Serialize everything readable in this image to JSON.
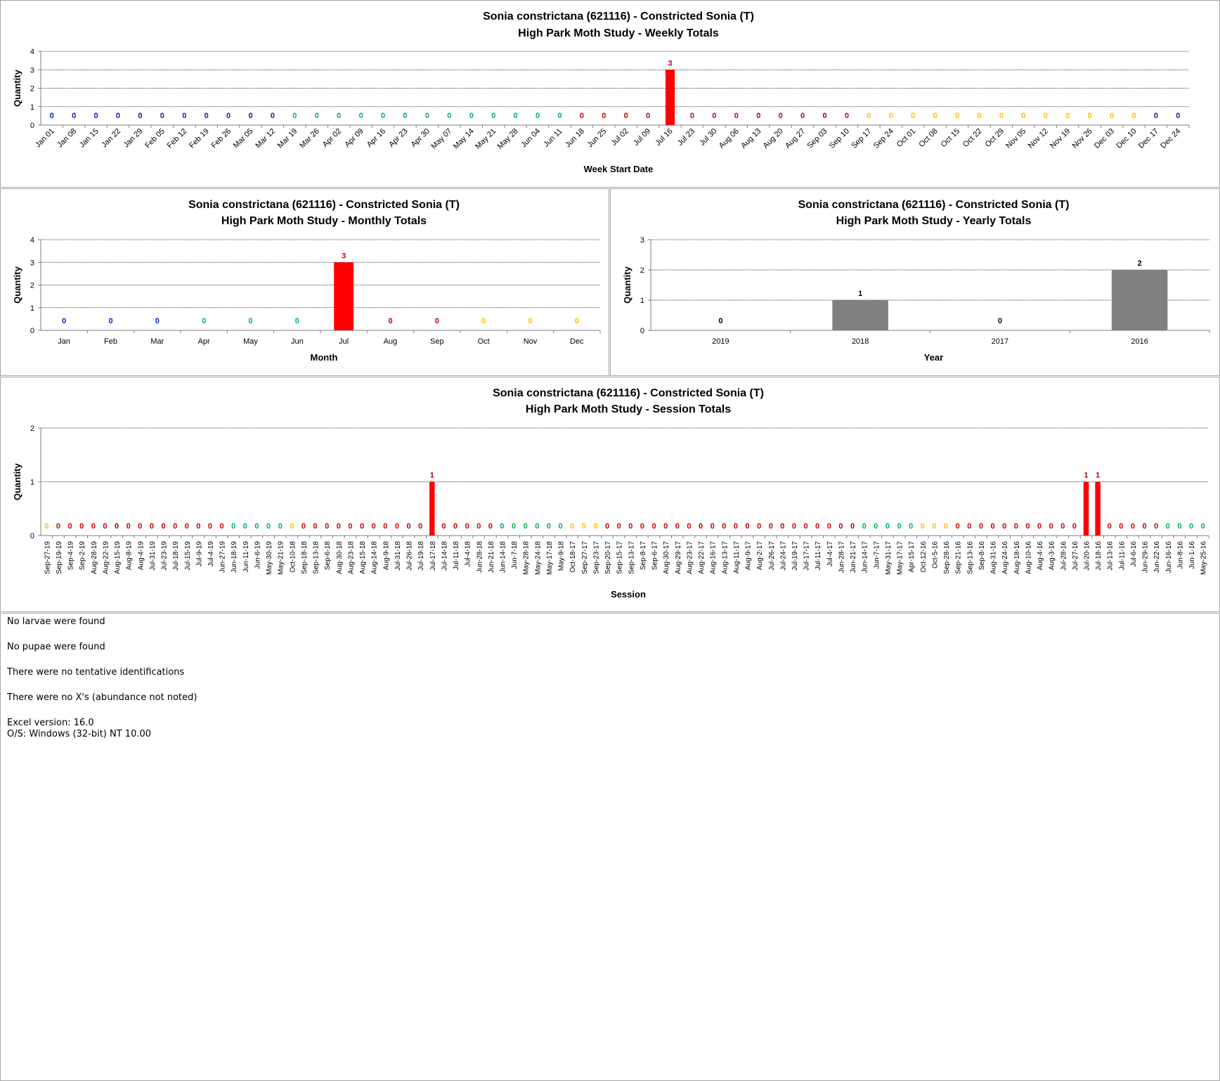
{
  "colors": {
    "bar_red": "#ff0000",
    "bar_gray": "#808080",
    "label_red": "#c00000",
    "label_blue": "#0020c0",
    "label_green": "#00b050",
    "label_yellow": "#ffc000",
    "label_black": "#000000"
  },
  "chart_data": [
    {
      "id": "weekly",
      "type": "bar",
      "title": "Sonia constrictana (621116)  - Constricted Sonia (T)",
      "subtitle": "High Park Moth Study  -  Weekly Totals",
      "xlabel": "Week Start Date",
      "ylabel": "Quantity",
      "ylim": [
        0,
        4
      ],
      "yticks": [
        0,
        1,
        2,
        3,
        4
      ],
      "grid": true,
      "bar_color": "#ff0000",
      "categories": [
        "Jan 01",
        "Jan 08",
        "Jan 15",
        "Jan 22",
        "Jan 29",
        "Feb 05",
        "Feb 12",
        "Feb 19",
        "Feb 26",
        "Mar 05",
        "Mar 12",
        "Mar 19",
        "Mar 26",
        "Apr 02",
        "Apr 09",
        "Apr 16",
        "Apr 23",
        "Apr 30",
        "May 07",
        "May 14",
        "May 21",
        "May 28",
        "Jun 04",
        "Jun 11",
        "Jun 18",
        "Jun 25",
        "Jul 02",
        "Jul 09",
        "Jul 16",
        "Jul 23",
        "Jul 30",
        "Aug 06",
        "Aug 13",
        "Aug 20",
        "Aug 27",
        "Sep 03",
        "Sep 10",
        "Sep 17",
        "Sep 24",
        "Oct 01",
        "Oct 08",
        "Oct 15",
        "Oct 22",
        "Oct 29",
        "Nov 05",
        "Nov 12",
        "Nov 19",
        "Nov 26",
        "Dec 03",
        "Dec 10",
        "Dec 17",
        "Dec 24"
      ],
      "values": [
        0,
        0,
        0,
        0,
        0,
        0,
        0,
        0,
        0,
        0,
        0,
        0,
        0,
        0,
        0,
        0,
        0,
        0,
        0,
        0,
        0,
        0,
        0,
        0,
        0,
        0,
        0,
        0,
        3,
        0,
        0,
        0,
        0,
        0,
        0,
        0,
        0,
        0,
        0,
        0,
        0,
        0,
        0,
        0,
        0,
        0,
        0,
        0,
        0,
        0,
        0,
        0
      ],
      "label_colors": [
        "b",
        "b",
        "b",
        "b",
        "b",
        "b",
        "b",
        "b",
        "b",
        "b",
        "b",
        "g",
        "g",
        "g",
        "g",
        "g",
        "g",
        "g",
        "g",
        "g",
        "g",
        "g",
        "g",
        "g",
        "r",
        "r",
        "r",
        "r",
        "r",
        "r",
        "r",
        "r",
        "r",
        "r",
        "r",
        "r",
        "r",
        "y",
        "y",
        "y",
        "y",
        "y",
        "y",
        "y",
        "y",
        "y",
        "y",
        "y",
        "y",
        "y",
        "b",
        "b"
      ]
    },
    {
      "id": "monthly",
      "type": "bar",
      "title": "Sonia constrictana (621116)  - Constricted Sonia (T)",
      "subtitle": "High Park Moth Study  -  Monthly Totals",
      "xlabel": "Month",
      "ylabel": "Quantity",
      "ylim": [
        0,
        4
      ],
      "yticks": [
        0,
        1,
        2,
        3,
        4
      ],
      "grid": true,
      "bar_color": "#ff0000",
      "categories": [
        "Jan",
        "Feb",
        "Mar",
        "Apr",
        "May",
        "Jun",
        "Jul",
        "Aug",
        "Sep",
        "Oct",
        "Nov",
        "Dec"
      ],
      "values": [
        0,
        0,
        0,
        0,
        0,
        0,
        3,
        0,
        0,
        0,
        0,
        0
      ],
      "label_colors": [
        "b",
        "b",
        "b",
        "g",
        "g",
        "g",
        "r",
        "r",
        "r",
        "y",
        "y",
        "y"
      ]
    },
    {
      "id": "yearly",
      "type": "bar",
      "title": "Sonia constrictana (621116)  - Constricted Sonia (T)",
      "subtitle": "High Park Moth Study  -  Yearly Totals",
      "xlabel": "Year",
      "ylabel": "Quantity",
      "ylim": [
        0,
        3
      ],
      "yticks": [
        0,
        1,
        2,
        3
      ],
      "grid": true,
      "bar_color": "#808080",
      "categories": [
        "2019",
        "2018",
        "2017",
        "2016"
      ],
      "values": [
        0,
        1,
        0,
        2
      ],
      "label_colors": [
        "k",
        "k",
        "k",
        "k"
      ]
    },
    {
      "id": "session",
      "type": "bar",
      "title": "Sonia constrictana (621116)  - Constricted Sonia (T)",
      "subtitle": "High Park Moth Study  -  Session Totals",
      "xlabel": "Session",
      "ylabel": "Quantity",
      "ylim": [
        0,
        2
      ],
      "yticks": [
        0,
        1,
        2
      ],
      "grid": true,
      "bar_color": "#ff0000",
      "categories": [
        "Sep-27-19",
        "Sep-19-19",
        "Sep-4-19",
        "Sep-2-19",
        "Aug-28-19",
        "Aug-22-19",
        "Aug-15-19",
        "Aug-8-19",
        "Aug-4-19",
        "Jul-31-19",
        "Jul-23-19",
        "Jul-18-19",
        "Jul-15-19",
        "Jul-9-19",
        "Jul-4-19",
        "Jun-27-19",
        "Jun-18-19",
        "Jun-11-19",
        "Jun-6-19",
        "May-30-19",
        "May-21-19",
        "Oct-10-18",
        "Sep-18-18",
        "Sep-13-18",
        "Sep-6-18",
        "Aug-30-18",
        "Aug-23-18",
        "Aug-15-18",
        "Aug-14-18",
        "Aug-9-18",
        "Jul-31-18",
        "Jul-26-18",
        "Jul-19-18",
        "Jul-17-18",
        "Jul-14-18",
        "Jul-11-18",
        "Jul-4-18",
        "Jun-28-18",
        "Jun-21-18",
        "Jun-14-18",
        "Jun-7-18",
        "May-28-18",
        "May-24-18",
        "May-17-18",
        "May-9-18",
        "Oct-18-17",
        "Sep-27-17",
        "Sep-23-17",
        "Sep-20-17",
        "Sep-15-17",
        "Sep-13-17",
        "Sep-8-17",
        "Sep-6-17",
        "Aug-30-17",
        "Aug-29-17",
        "Aug-23-17",
        "Aug-22-17",
        "Aug-16-17",
        "Aug-13-17",
        "Aug-11-17",
        "Aug-9-17",
        "Aug-2-17",
        "Jul-26-17",
        "Jul-24-17",
        "Jul-19-17",
        "Jul-17-17",
        "Jul-11-17",
        "Jul-4-17",
        "Jun-28-17",
        "Jun-21-17",
        "Jun-14-17",
        "Jun-7-17",
        "May-31-17",
        "May-17-17",
        "Apr-15-17",
        "Oct-12-16",
        "Oct-5-16",
        "Sep-28-16",
        "Sep-21-16",
        "Sep-13-16",
        "Sep-8-16",
        "Aug-31-16",
        "Aug-24-16",
        "Aug-18-16",
        "Aug-10-16",
        "Aug-4-16",
        "Aug-3-16",
        "Jul-28-16",
        "Jul-27-16",
        "Jul-20-16",
        "Jul-18-16",
        "Jul-13-16",
        "Jul-11-16",
        "Jul-6-16",
        "Jun-29-16",
        "Jun-22-16",
        "Jun-16-16",
        "Jun-8-16",
        "Jun-1-16",
        "May-25-16"
      ],
      "values": [
        0,
        0,
        0,
        0,
        0,
        0,
        0,
        0,
        0,
        0,
        0,
        0,
        0,
        0,
        0,
        0,
        0,
        0,
        0,
        0,
        0,
        0,
        0,
        0,
        0,
        0,
        0,
        0,
        0,
        0,
        0,
        0,
        0,
        1,
        0,
        0,
        0,
        0,
        0,
        0,
        0,
        0,
        0,
        0,
        0,
        0,
        0,
        0,
        0,
        0,
        0,
        0,
        0,
        0,
        0,
        0,
        0,
        0,
        0,
        0,
        0,
        0,
        0,
        0,
        0,
        0,
        0,
        0,
        0,
        0,
        0,
        0,
        0,
        0,
        0,
        0,
        0,
        0,
        0,
        0,
        0,
        0,
        0,
        0,
        0,
        0,
        0,
        0,
        0,
        1,
        1,
        0,
        0,
        0,
        0,
        0,
        0,
        0,
        0,
        0
      ],
      "label_colors": [
        "y",
        "r",
        "r",
        "r",
        "r",
        "r",
        "r",
        "r",
        "r",
        "r",
        "r",
        "r",
        "r",
        "r",
        "r",
        "r",
        "g",
        "g",
        "g",
        "g",
        "g",
        "y",
        "r",
        "r",
        "r",
        "r",
        "r",
        "r",
        "r",
        "r",
        "r",
        "r",
        "r",
        "r",
        "r",
        "r",
        "r",
        "r",
        "r",
        "g",
        "g",
        "g",
        "g",
        "g",
        "g",
        "y",
        "y",
        "y",
        "r",
        "r",
        "r",
        "r",
        "r",
        "r",
        "r",
        "r",
        "r",
        "r",
        "r",
        "r",
        "r",
        "r",
        "r",
        "r",
        "r",
        "r",
        "r",
        "r",
        "r",
        "r",
        "g",
        "g",
        "g",
        "g",
        "g",
        "y",
        "y",
        "y",
        "r",
        "r",
        "r",
        "r",
        "r",
        "r",
        "r",
        "r",
        "r",
        "r",
        "r",
        "r",
        "r",
        "r",
        "r",
        "r",
        "r",
        "r",
        "g",
        "g",
        "g",
        "g"
      ]
    }
  ],
  "notes": {
    "larvae": "No larvae were found",
    "pupae": "No pupae were found",
    "tentative": "There were no tentative identifications",
    "xs": "There were no X's (abundance not noted)",
    "excel": "Excel version: 16.0",
    "os": "O/S: Windows (32-bit) NT 10.00"
  }
}
